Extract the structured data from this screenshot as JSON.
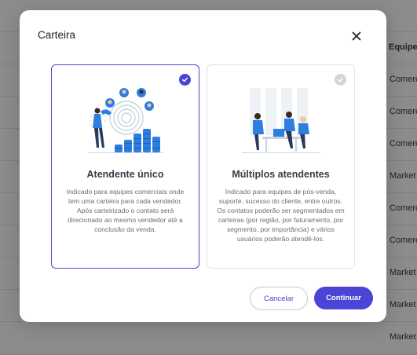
{
  "background": {
    "column_header": "Equipe",
    "rows": [
      "Comerc",
      "Comerc",
      "Comerc",
      "Market",
      "Comerc",
      "Comerc",
      "Market",
      "Market",
      "Market"
    ]
  },
  "modal": {
    "title": "Carteira",
    "close_icon": "close-icon",
    "options": [
      {
        "title": "Atendente único",
        "description": "Indicado para equipes comerciais onde tem uma carteira para cada vendedor. Após carteirizado o contato será direcionado ao mesmo vendedor até a conclusão da venda.",
        "selected": true,
        "icon": "magnet-coins-illustration"
      },
      {
        "title": "Múltiplos atendentes",
        "description": "Indicado para equipes de pós-venda, suporte, sucesso do cliente, entre outros. Os contatos poderão ser segmentados em carteiras (por região, por faturamento, por segmento, por importância) e vários usuários poderão atendê-los.",
        "selected": false,
        "icon": "team-meeting-illustration"
      }
    ],
    "cancel_label": "Cancelar",
    "continue_label": "Continuar"
  },
  "colors": {
    "accent": "#4a45d6",
    "illustration_blue": "#2e7de0"
  }
}
